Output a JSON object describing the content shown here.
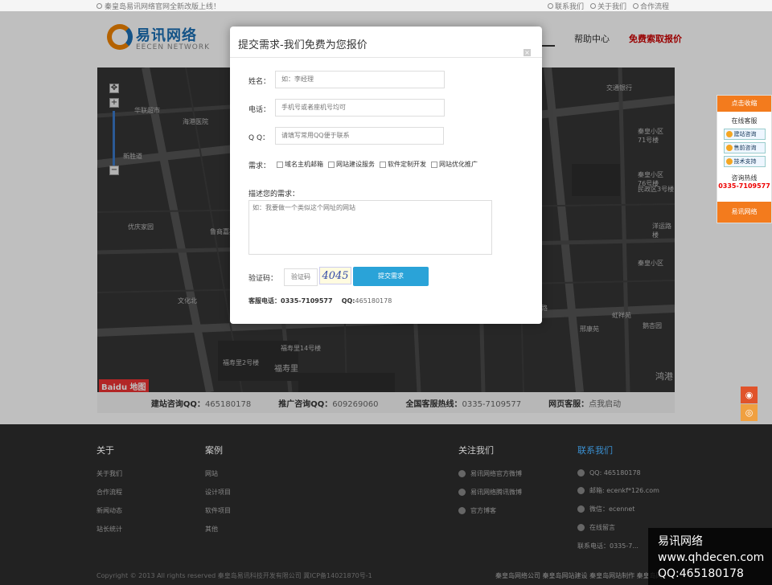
{
  "topbar": {
    "notice": "秦皇岛易讯网络官网全新改版上线！",
    "links": [
      "联系我们",
      "关于我们",
      "合作流程"
    ]
  },
  "logo": {
    "cn": "易讯网络",
    "en": "EECEN NETWORK"
  },
  "nav": {
    "items": [
      "帮助中心",
      "免费索取报价"
    ]
  },
  "map": {
    "labels": [
      "华联超市",
      "海港医院",
      "新胜道",
      "优庆家园",
      "鲁商嘉苑",
      "交通银行",
      "秦皇小区71号楼",
      "秦皇小区76号楼",
      "民政区3号楼",
      "洋运路楼",
      "文化北",
      "福寿里14号楼",
      "福寿里",
      "福寿里2号楼",
      "虹祥苑",
      "东环路",
      "秦皇小区",
      "鹅杏园",
      "邢康苑",
      "鸿港"
    ],
    "logo": "Baidu 地图"
  },
  "contact_bar": {
    "items": [
      {
        "label": "建站咨询QQ：",
        "value": "465180178"
      },
      {
        "label": "推广咨询QQ：",
        "value": "609269060"
      },
      {
        "label": "全国客服热线：",
        "value": "0335-7109577"
      },
      {
        "label": "网页客服：",
        "value": "点我启动"
      }
    ]
  },
  "footer": {
    "col1": {
      "title": "关于",
      "items": [
        "关于我们",
        "合作流程",
        "新闻动态",
        "站长统计"
      ]
    },
    "col2": {
      "title": "案例",
      "items": [
        "网站",
        "设计项目",
        "软件项目",
        "其他"
      ]
    },
    "col3": {
      "title": "关注我们",
      "items": [
        "易讯网络官方微博",
        "易讯网络腾讯微博",
        "官方博客"
      ]
    },
    "col4": {
      "title": "联系我们",
      "items": [
        "QQ: 465180178",
        "邮箱: ecenkf*126.com",
        "微信：ecennet",
        "在线留言",
        "联系电话：0335-7..."
      ]
    },
    "copyright": "Copyright © 2013 All rights reserved  秦皇岛易讯科技开发有限公司 冀ICP备14021870号-1",
    "copyright2": "秦皇岛网络公司 秦皇岛网站建设 秦皇岛网站制作 秦皇岛网"
  },
  "float_panel": {
    "head": "点击收缩",
    "title": "在线客服",
    "buttons": [
      "建站咨询",
      "售前咨询",
      "技术支持"
    ],
    "hotline_label": "咨询热线",
    "hotline": "0335-7109577",
    "foot": "易讯网络"
  },
  "modal": {
    "title": "提交需求-我们免费为您报价",
    "name_label": "姓名：",
    "name_placeholder": "如：李经理",
    "phone_label": "电话：",
    "phone_placeholder": "手机号或者座机号均可",
    "qq_label": "Q Q：",
    "qq_placeholder": "请填写常用QQ便于联系",
    "need_label": "需求：",
    "needs": [
      "域名主机邮箱",
      "网站建设服务",
      "软件定制开发",
      "网站优化推广"
    ],
    "desc_label": "描述您的需求：",
    "desc_placeholder": "如：我要做一个类似这个网址的网站",
    "captcha_label": "验证码：",
    "captcha_placeholder": "验证码",
    "captcha_text": "4045",
    "submit": "提交需求",
    "footer_phone": "客服电话：0335-7109577",
    "footer_qq_label": "QQ:",
    "footer_qq": "465180178"
  },
  "watermark": {
    "line1": "易讯网络",
    "line2": "www.qhdecen.com",
    "line3": "QQ:465180178"
  }
}
